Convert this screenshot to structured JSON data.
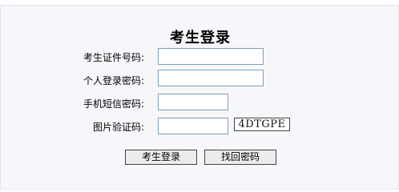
{
  "form": {
    "title": "考生登录",
    "fields": {
      "exam_id": {
        "label": "考生证件号码:",
        "value": ""
      },
      "password": {
        "label": "个人登录密码:",
        "value": ""
      },
      "sms_code": {
        "label": "手机短信密码:",
        "value": ""
      },
      "captcha": {
        "label": "图片验证码:",
        "value": "",
        "image_text": "4DTGPE"
      }
    },
    "buttons": {
      "login": "考生登录",
      "retrieve_password": "找回密码"
    }
  }
}
